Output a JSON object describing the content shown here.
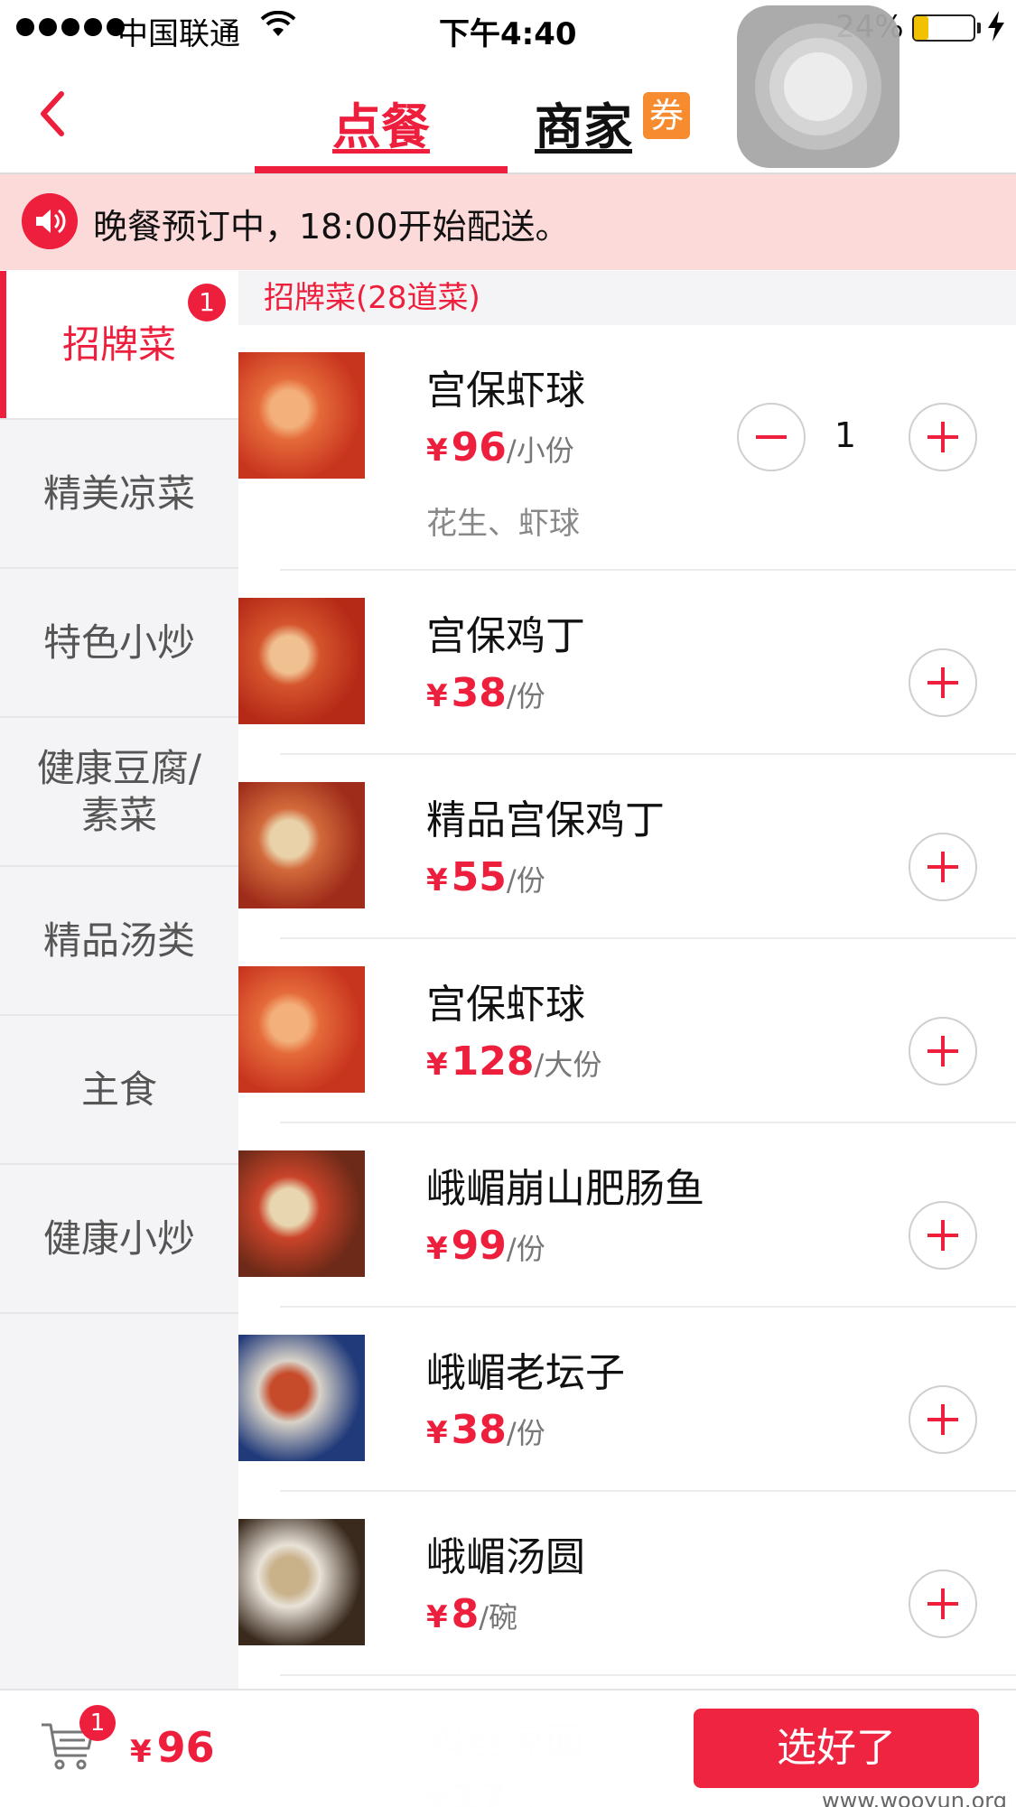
{
  "status_bar": {
    "carrier": "中国联通",
    "time": "下午4:40",
    "battery_percent": "24%",
    "battery_level": 0.24,
    "signal_dots": 5
  },
  "nav": {
    "tab_order": "点餐",
    "tab_merchant": "商家",
    "coupon_badge": "券",
    "active_tab": "点餐"
  },
  "notice": {
    "text": "晚餐预订中，18:00开始配送。"
  },
  "sidebar": {
    "items": [
      {
        "label": "招牌菜",
        "badge": "1",
        "active": true
      },
      {
        "label": "精美凉菜",
        "badge": "",
        "active": false
      },
      {
        "label": "特色小炒",
        "badge": "",
        "active": false
      },
      {
        "label": "健康豆腐/\n素菜",
        "badge": "",
        "active": false
      },
      {
        "label": "精品汤类",
        "badge": "",
        "active": false
      },
      {
        "label": "主食",
        "badge": "",
        "active": false
      },
      {
        "label": "健康小炒",
        "badge": "",
        "active": false
      }
    ]
  },
  "section": {
    "header": "招牌菜(28道菜)"
  },
  "dishes": [
    {
      "name": "宫保虾球",
      "currency": "¥",
      "price": "96",
      "unit": "/小份",
      "desc": "花生、虾球",
      "qty": "1"
    },
    {
      "name": "宫保鸡丁",
      "currency": "¥",
      "price": "38",
      "unit": "/份",
      "desc": "",
      "qty": ""
    },
    {
      "name": "精品宫保鸡丁",
      "currency": "¥",
      "price": "55",
      "unit": "/份",
      "desc": "",
      "qty": ""
    },
    {
      "name": "宫保虾球",
      "currency": "¥",
      "price": "128",
      "unit": "/大份",
      "desc": "",
      "qty": ""
    },
    {
      "name": "峨嵋崩山肥肠鱼",
      "currency": "¥",
      "price": "99",
      "unit": "/份",
      "desc": "",
      "qty": ""
    },
    {
      "name": "峨嵋老坛子",
      "currency": "¥",
      "price": "38",
      "unit": "/份",
      "desc": "",
      "qty": ""
    },
    {
      "name": "峨嵋汤圆",
      "currency": "¥",
      "price": "8",
      "unit": "/碗",
      "desc": "",
      "qty": ""
    },
    {
      "name": "鸡丝凉面",
      "currency": "¥",
      "price": "17",
      "unit": "/份",
      "desc": "",
      "qty": ""
    }
  ],
  "cart": {
    "badge": "1",
    "currency": "¥",
    "total": "96"
  },
  "confirm_button": "选好了",
  "watermark": "www.wooyun.org",
  "colors": {
    "accent": "#ee1f3c",
    "notice_bg": "#fddada",
    "sidebar_bg": "#f4f4f6",
    "coupon": "#f78b2f"
  },
  "icons": {
    "back": "chevron-left-icon",
    "speaker": "speaker-icon",
    "cart": "cart-icon",
    "plus": "plus-icon",
    "minus": "minus-icon"
  }
}
